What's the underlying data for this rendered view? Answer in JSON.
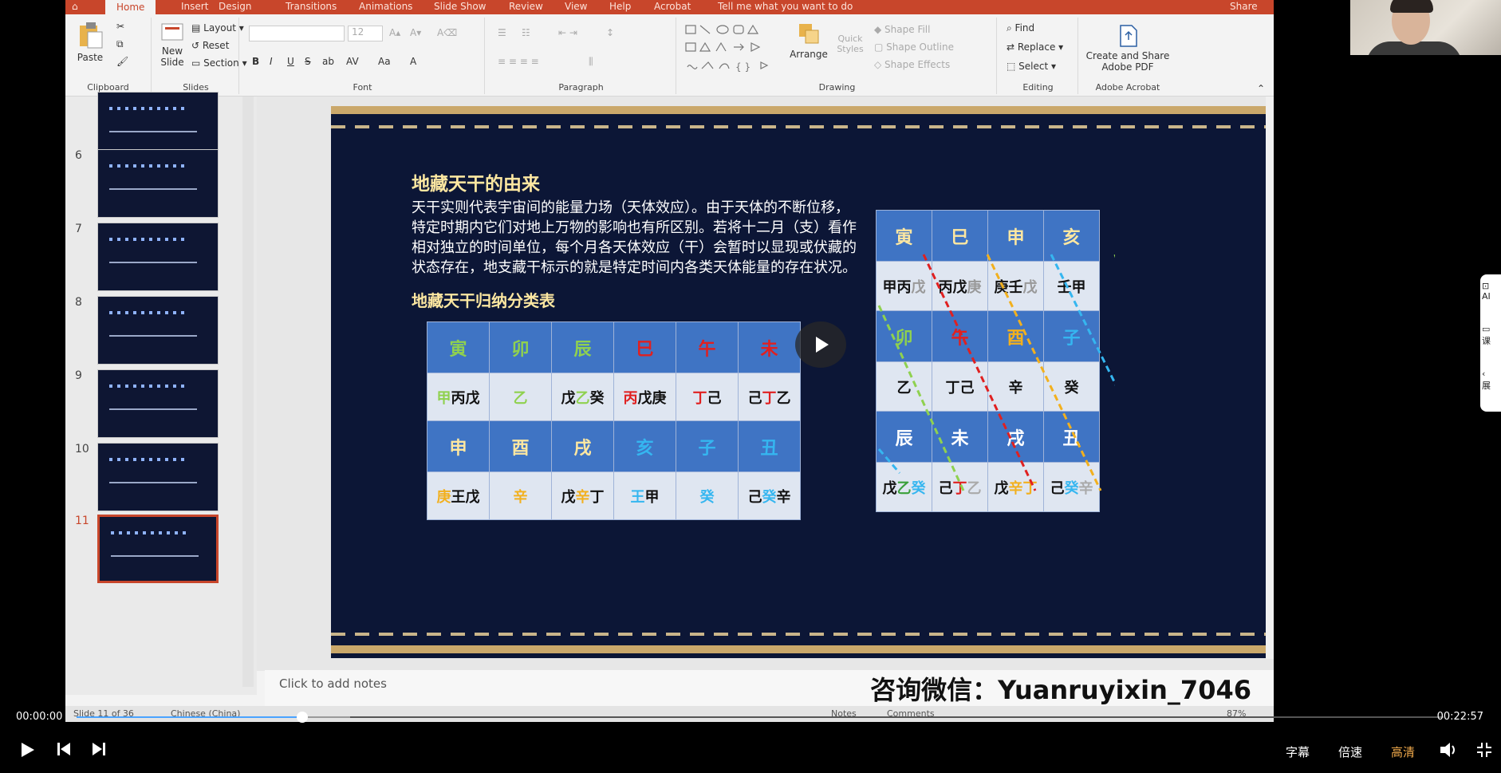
{
  "ribbon": {
    "tabs": [
      "Home",
      "Insert",
      "Design",
      "Transitions",
      "Animations",
      "Slide Show",
      "Review",
      "View",
      "Help",
      "Acrobat",
      "Tell me what you want to do",
      "Share"
    ],
    "clipboard": {
      "paste": "Paste",
      "label": "Clipboard"
    },
    "slides": {
      "new_slide": "New Slide",
      "layout": "Layout",
      "reset": "Reset",
      "section": "Section",
      "label": "Slides"
    },
    "font": {
      "label": "Font",
      "size": "12",
      "btns": [
        "B",
        "I",
        "U",
        "S",
        "ab",
        "AV",
        "Aa",
        "A"
      ]
    },
    "paragraph": {
      "label": "Paragraph"
    },
    "drawing": {
      "arrange": "Arrange",
      "quick_styles": "Quick Styles",
      "shape_fill": "Shape Fill",
      "shape_outline": "Shape Outline",
      "shape_effects": "Shape Effects",
      "label": "Drawing"
    },
    "editing": {
      "find": "Find",
      "replace": "Replace",
      "select": "Select",
      "label": "Editing"
    },
    "acrobat": {
      "create": "Create and Share Adobe PDF",
      "label": "Adobe Acrobat"
    }
  },
  "thumbnails": [
    {
      "num": "",
      "selected": false
    },
    {
      "num": "6",
      "selected": false
    },
    {
      "num": "7",
      "selected": false
    },
    {
      "num": "8",
      "selected": false
    },
    {
      "num": "9",
      "selected": false
    },
    {
      "num": "10",
      "selected": false
    },
    {
      "num": "11",
      "selected": true
    }
  ],
  "slide": {
    "title": "地藏天干的由来",
    "paragraph": [
      "天干实则代表宇宙间的能量力场（天体效应）。由于天体的不断位移，",
      "特定时期内它们对地上万物的影响也有所区别。若将十二月（支）看作",
      "相对独立的时间单位，每个月各天体效应（干）会暂时以显现或伏藏的",
      "状态存在，地支藏干标示的就是特定时间内各类天体能量的存在状况。"
    ],
    "subtitle": "地藏天干归纳分类表",
    "left_table": [
      {
        "type": "hd",
        "cells": [
          [
            [
              "寅",
              "#8fd14f"
            ]
          ],
          [
            [
              "卯",
              "#8fd14f"
            ]
          ],
          [
            [
              "辰",
              "#8fd14f"
            ]
          ],
          [
            [
              "巳",
              "#e02020"
            ]
          ],
          [
            [
              "午",
              "#e02020"
            ]
          ],
          [
            [
              "未",
              "#e02020"
            ]
          ]
        ]
      },
      {
        "type": "bd",
        "cells": [
          [
            [
              "甲",
              "#8fd14f"
            ],
            [
              "丙",
              "#111"
            ],
            [
              "戊",
              "#111"
            ]
          ],
          [
            [
              "乙",
              "#8fd14f"
            ]
          ],
          [
            [
              "戊",
              "#111"
            ],
            [
              "乙",
              "#8fd14f"
            ],
            [
              "癸",
              "#111"
            ]
          ],
          [
            [
              "丙",
              "#e02020"
            ],
            [
              "戊",
              "#111"
            ],
            [
              "庚",
              "#111"
            ]
          ],
          [
            [
              "丁",
              "#e02020"
            ],
            [
              "己",
              "#111"
            ]
          ],
          [
            [
              "己",
              "#111"
            ],
            [
              "丁",
              "#e02020"
            ],
            [
              "乙",
              "#111"
            ]
          ]
        ]
      },
      {
        "type": "hd",
        "cells": [
          [
            [
              "申",
              "#fde7a1"
            ]
          ],
          [
            [
              "酉",
              "#fde7a1"
            ]
          ],
          [
            [
              "戌",
              "#fde7a1"
            ]
          ],
          [
            [
              "亥",
              "#35b6f0"
            ]
          ],
          [
            [
              "子",
              "#35b6f0"
            ]
          ],
          [
            [
              "丑",
              "#35b6f0"
            ]
          ]
        ]
      },
      {
        "type": "bd",
        "cells": [
          [
            [
              "庚",
              "#f2b01e"
            ],
            [
              "王",
              "#111"
            ],
            [
              "戊",
              "#111"
            ]
          ],
          [
            [
              "辛",
              "#f2b01e"
            ]
          ],
          [
            [
              "戊",
              "#111"
            ],
            [
              "辛",
              "#f2b01e"
            ],
            [
              "丁",
              "#111"
            ]
          ],
          [
            [
              "王",
              "#35b6f0"
            ],
            [
              "甲",
              "#111"
            ]
          ],
          [
            [
              "癸",
              "#35b6f0"
            ]
          ],
          [
            [
              "己",
              "#111"
            ],
            [
              "癸",
              "#35b6f0"
            ],
            [
              "辛",
              "#111"
            ]
          ]
        ]
      }
    ],
    "right_table": [
      {
        "type": "hd",
        "cells": [
          [
            [
              "寅",
              "#fde7a1"
            ]
          ],
          [
            [
              "巳",
              "#fde7a1"
            ]
          ],
          [
            [
              "申",
              "#fde7a1"
            ]
          ],
          [
            [
              "亥",
              "#fde7a1"
            ]
          ]
        ]
      },
      {
        "type": "bd",
        "cells": [
          [
            [
              "甲",
              "#111"
            ],
            [
              "丙",
              "#111"
            ],
            [
              "戊",
              "#999"
            ]
          ],
          [
            [
              "丙",
              "#111"
            ],
            [
              "戊",
              "#111"
            ],
            [
              "庚",
              "#999"
            ]
          ],
          [
            [
              "庚",
              "#111"
            ],
            [
              "壬",
              "#111"
            ],
            [
              "戊",
              "#999"
            ]
          ],
          [
            [
              "壬",
              "#111"
            ],
            [
              "甲",
              "#111"
            ]
          ]
        ]
      },
      {
        "type": "hd",
        "cells": [
          [
            [
              "卯",
              "#8fd14f"
            ]
          ],
          [
            [
              "午",
              "#e02020"
            ]
          ],
          [
            [
              "酉",
              "#f2b01e"
            ]
          ],
          [
            [
              "子",
              "#35b6f0"
            ]
          ]
        ]
      },
      {
        "type": "bd",
        "cells": [
          [
            [
              "乙",
              "#111"
            ]
          ],
          [
            [
              "丁",
              "#111"
            ],
            [
              "己",
              "#111"
            ]
          ],
          [
            [
              "辛",
              "#111"
            ]
          ],
          [
            [
              "癸",
              "#111"
            ]
          ]
        ]
      },
      {
        "type": "hd",
        "cells": [
          [
            [
              "辰",
              "#fff"
            ]
          ],
          [
            [
              "未",
              "#fff"
            ]
          ],
          [
            [
              "戌",
              "#fff"
            ]
          ],
          [
            [
              "丑",
              "#fff"
            ]
          ]
        ]
      },
      {
        "type": "bd",
        "cells": [
          [
            [
              "戊",
              "#111"
            ],
            [
              "乙",
              "#3aa03a"
            ],
            [
              "癸",
              "#35b6f0"
            ]
          ],
          [
            [
              "己",
              "#111"
            ],
            [
              "丁",
              "#e02020"
            ],
            [
              "乙",
              "#aaa"
            ]
          ],
          [
            [
              "戊",
              "#111"
            ],
            [
              "辛",
              "#f2b01e"
            ],
            [
              "丁",
              "#f2b01e"
            ]
          ],
          [
            [
              "己",
              "#111"
            ],
            [
              "癸",
              "#35b6f0"
            ],
            [
              "辛",
              "#aaa"
            ]
          ]
        ]
      }
    ]
  },
  "notes": {
    "placeholder": "Click to add notes",
    "watermark": "咨询微信：Yuanruyixin_7046"
  },
  "status": {
    "slide": "Slide 11 of 36",
    "lang": "Chinese (China)",
    "notes": "Notes",
    "comments": "Comments",
    "zoom": "87%"
  },
  "player": {
    "current": "00:00:00",
    "total": "00:22:57",
    "progress": 0.165,
    "buffered": 0.2,
    "subtitle": "字幕",
    "speed": "倍速",
    "quality": "高清"
  },
  "sidepanel": {
    "items": [
      "AI",
      "课",
      "展"
    ]
  },
  "colors": {
    "ribbon_red": "#c8462b",
    "slide_bg": "#0c1636",
    "header_blue": "#3f74c4",
    "gold": "#caa86b"
  }
}
